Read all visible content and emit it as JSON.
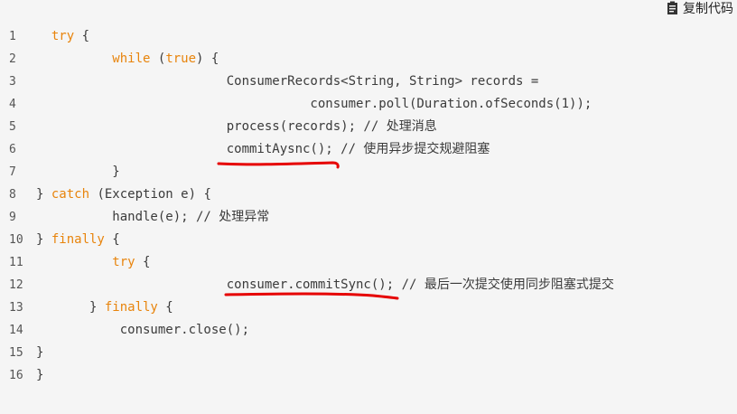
{
  "toolbar": {
    "copy_label": "复制代码",
    "icon": "clipboard-icon"
  },
  "code": {
    "line_numbers": [
      "1",
      "2",
      "3",
      "4",
      "5",
      "6",
      "7",
      "8",
      "9",
      "10",
      "11",
      "12",
      "13",
      "14",
      "15",
      "16"
    ],
    "lines": [
      [
        "  ",
        {
          "kw": "try"
        },
        " {"
      ],
      [
        "          ",
        {
          "kw": "while"
        },
        " (",
        {
          "kw": "true"
        },
        ") {"
      ],
      [
        "                         ConsumerRecords<String, String> records ="
      ],
      [
        "                                    consumer.poll(Duration.ofSeconds(1));"
      ],
      [
        "                         process(records); // 处理消息"
      ],
      [
        "                         commitAysnc(); // 使用异步提交规避阻塞"
      ],
      [
        "          }"
      ],
      [
        "} ",
        {
          "kw": "catch"
        },
        " (Exception e) {"
      ],
      [
        "          handle(e); // 处理异常"
      ],
      [
        "} ",
        {
          "kw": "finally"
        },
        " {"
      ],
      [
        "          ",
        {
          "kw": "try"
        },
        " {"
      ],
      [
        "                         consumer.commitSync(); // 最后一次提交使用同步阻塞式提交"
      ],
      [
        "       } ",
        {
          "kw": "finally"
        },
        " {"
      ],
      [
        "           consumer.close();"
      ],
      [
        "}"
      ],
      [
        "}"
      ]
    ]
  },
  "colors": {
    "background": "#f5f5f5",
    "keyword": "#e8840c",
    "text": "#3b3b3b",
    "annotation": "#e60000"
  }
}
